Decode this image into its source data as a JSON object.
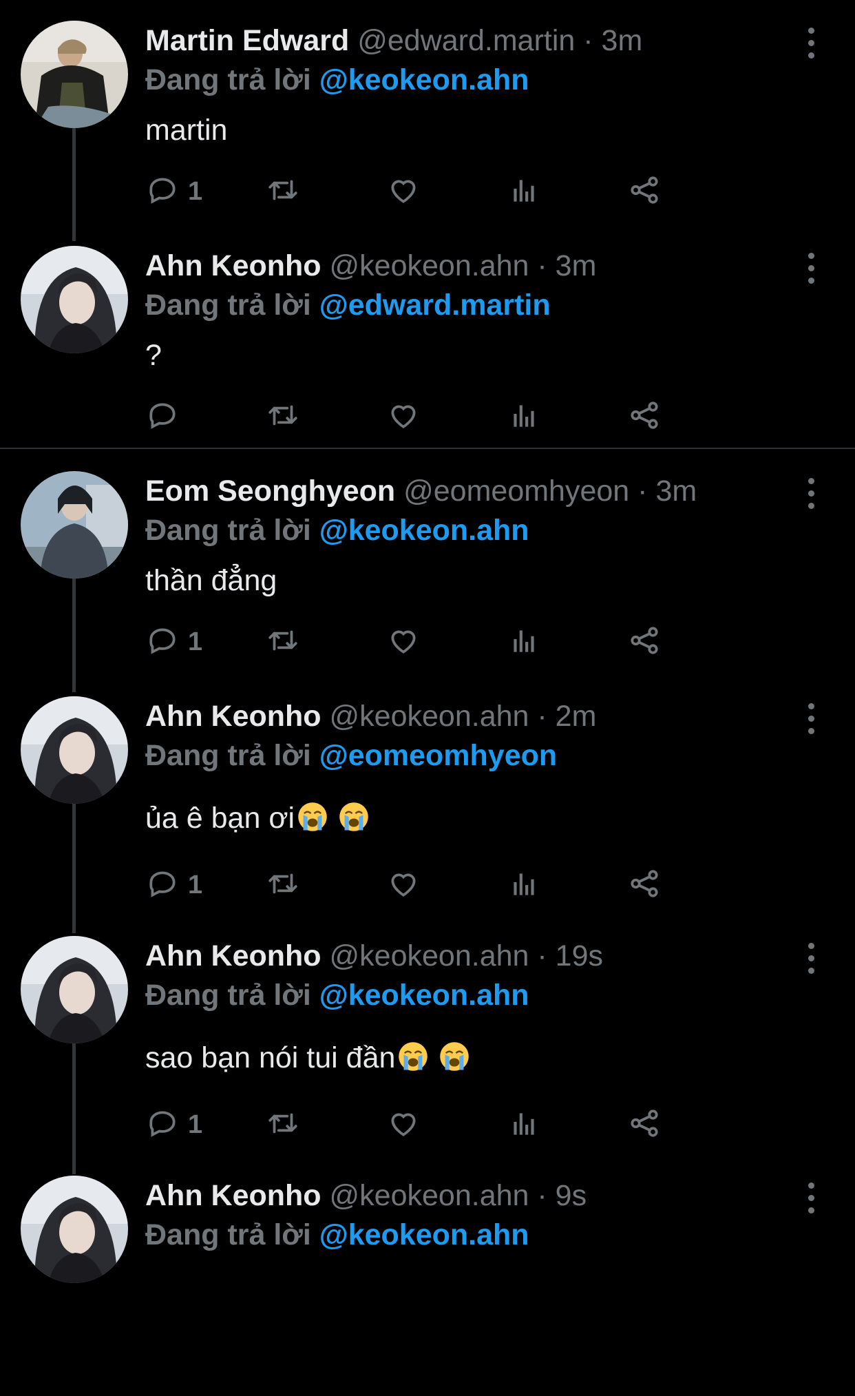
{
  "reply_prefix": "Đang trả lời",
  "tweets": [
    {
      "name": "Martin Edward",
      "handle": "@edward.martin",
      "time": "3m",
      "mention": "@keokeon.ahn",
      "text": "martin",
      "reply_count": "1",
      "emoji_count": 0
    },
    {
      "name": "Ahn Keonho",
      "handle": "@keokeon.ahn",
      "time": "3m",
      "mention": "@edward.martin",
      "text": "?",
      "reply_count": "",
      "emoji_count": 0
    },
    {
      "name": "Eom Seonghyeon",
      "handle": "@eomeomhyeon",
      "time": "3m",
      "mention": "@keokeon.ahn",
      "text": "thần đẳng",
      "reply_count": "1",
      "emoji_count": 0
    },
    {
      "name": "Ahn Keonho",
      "handle": "@keokeon.ahn",
      "time": "2m",
      "mention": "@eomeomhyeon",
      "text": "ủa ê bạn ơi",
      "reply_count": "1",
      "emoji_count": 2
    },
    {
      "name": "Ahn Keonho",
      "handle": "@keokeon.ahn",
      "time": "19s",
      "mention": "@keokeon.ahn",
      "text": "sao bạn nói tui đần",
      "reply_count": "1",
      "emoji_count": 2
    },
    {
      "name": "Ahn Keonho",
      "handle": "@keokeon.ahn",
      "time": "9s",
      "mention": "@keokeon.ahn",
      "text": "",
      "reply_count": "",
      "emoji_count": 0
    }
  ],
  "icons": {
    "reply": "reply-icon",
    "retweet": "retweet-icon",
    "like": "heart-icon",
    "views": "views-icon",
    "share": "share-icon",
    "more": "more-options-icon",
    "emoji": "loudly-crying-face-emoji"
  },
  "colors": {
    "background": "#000000",
    "text": "#e7e9ea",
    "muted": "#71767b",
    "accent": "#1d9bf0",
    "thread": "#333639"
  }
}
